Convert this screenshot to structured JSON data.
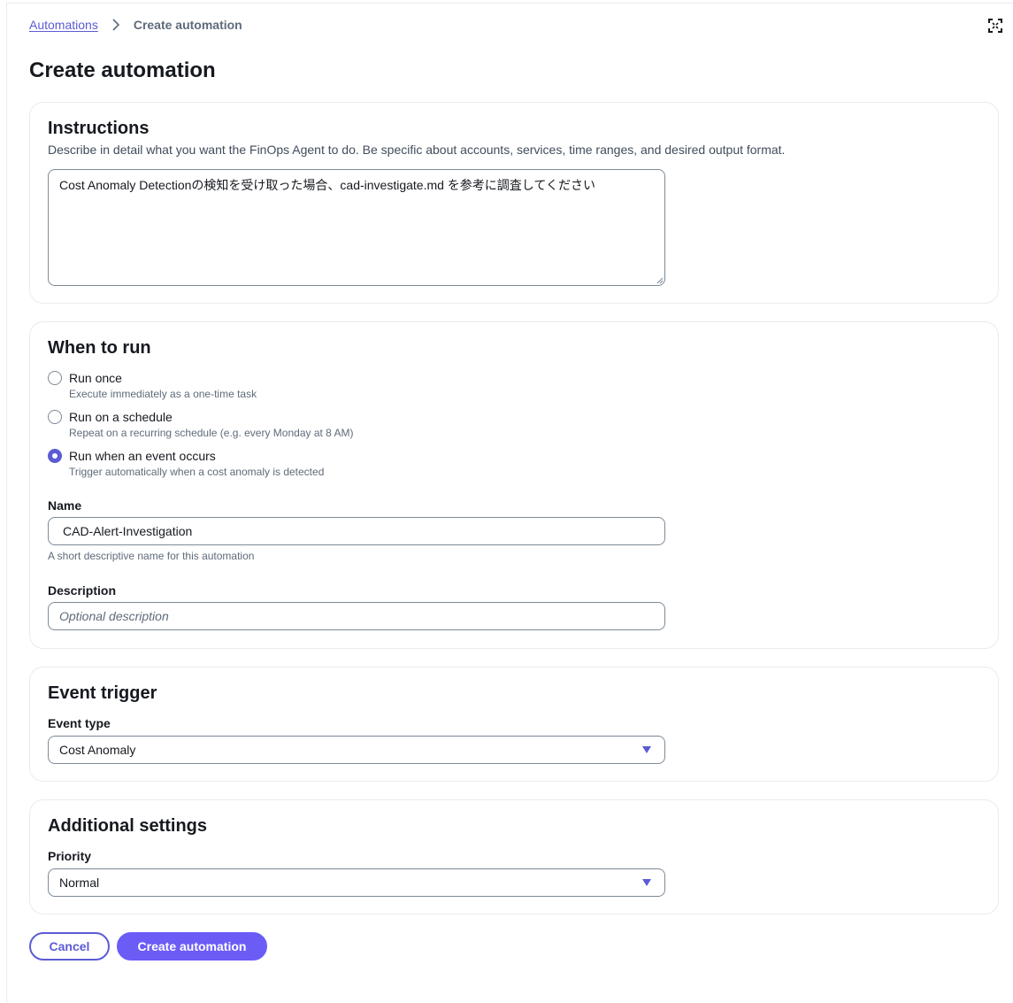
{
  "breadcrumb": {
    "parent": "Automations",
    "current": "Create automation"
  },
  "page_title": "Create automation",
  "instructions": {
    "title": "Instructions",
    "description": "Describe in detail what you want the FinOps Agent to do. Be specific about accounts, services, time ranges, and desired output format.",
    "value": "Cost Anomaly Detectionの検知を受け取った場合、cad-investigate.md を参考に調査してください"
  },
  "when_to_run": {
    "title": "When to run",
    "options": [
      {
        "label": "Run once",
        "description": "Execute immediately as a one-time task",
        "selected": false
      },
      {
        "label": "Run on a schedule",
        "description": "Repeat on a recurring schedule (e.g. every Monday at 8 AM)",
        "selected": false
      },
      {
        "label": "Run when an event occurs",
        "description": "Trigger automatically when a cost anomaly is detected",
        "selected": true
      }
    ],
    "name": {
      "label": "Name",
      "value": "CAD-Alert-Investigation",
      "hint": "A short descriptive name for this automation"
    },
    "description": {
      "label": "Description",
      "placeholder": "Optional description"
    }
  },
  "event_trigger": {
    "title": "Event trigger",
    "event_type_label": "Event type",
    "event_type_value": "Cost Anomaly"
  },
  "additional_settings": {
    "title": "Additional settings",
    "priority_label": "Priority",
    "priority_value": "Normal"
  },
  "actions": {
    "cancel": "Cancel",
    "create": "Create automation"
  },
  "icons": {
    "breadcrumb_separator": "chevron-right-icon",
    "fullscreen": "expand-icon",
    "select_caret": "caret-down-icon"
  },
  "colors": {
    "accent": "#5b5bd6",
    "primary_button": "#6b5cf6",
    "border": "#7d8998",
    "card_border": "#e9ebed"
  }
}
